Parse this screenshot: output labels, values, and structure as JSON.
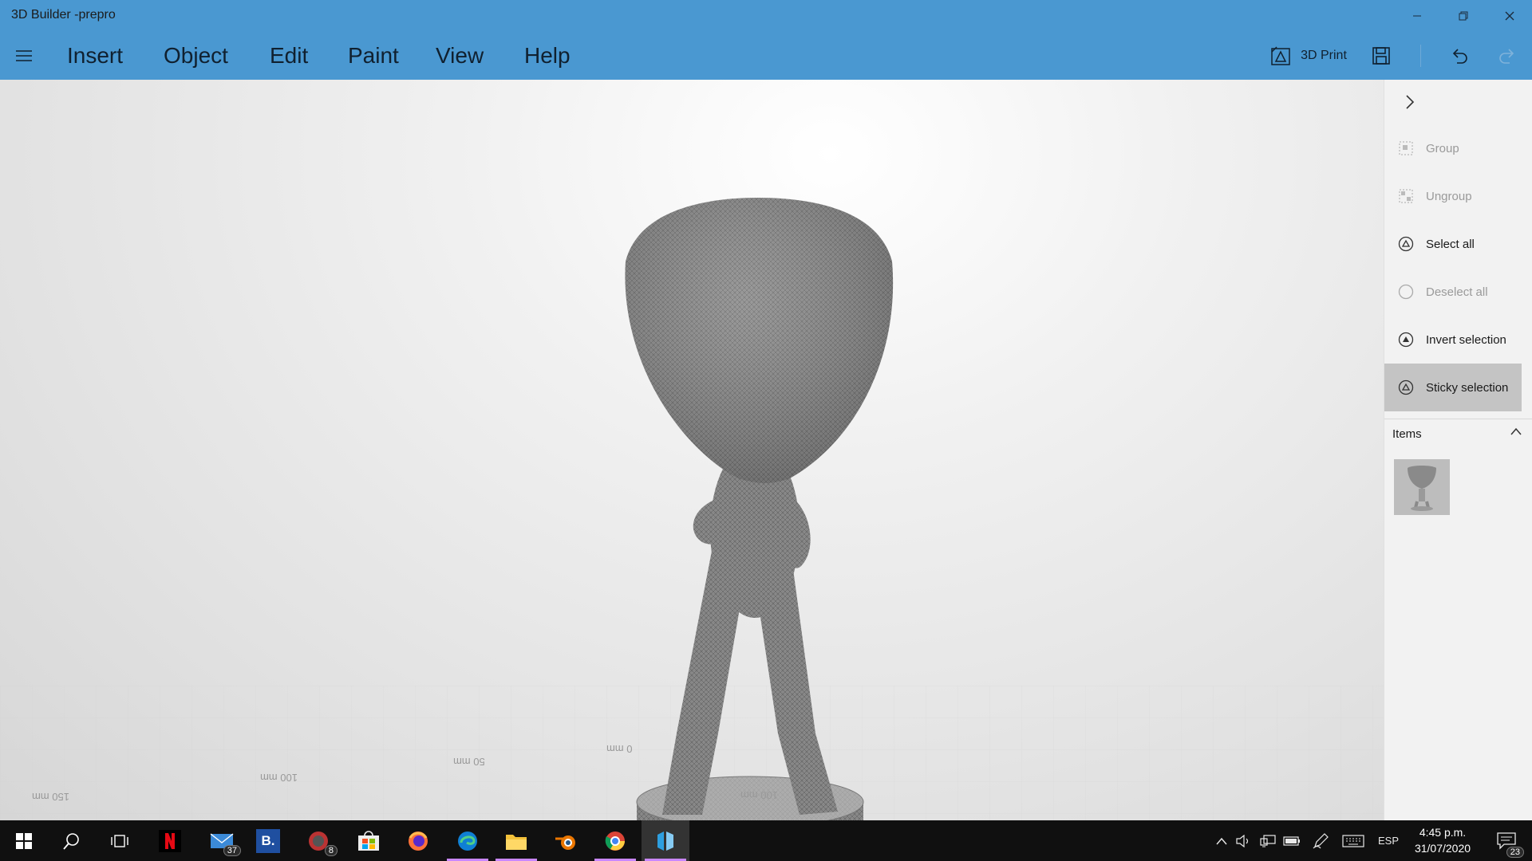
{
  "window": {
    "title": "3D Builder -prepro"
  },
  "menu": {
    "items": [
      {
        "label": "Insert"
      },
      {
        "label": "Object"
      },
      {
        "label": "Edit"
      },
      {
        "label": "Paint"
      },
      {
        "label": "View"
      },
      {
        "label": "Help"
      }
    ],
    "print_label": "3D Print"
  },
  "viewport": {
    "rulers": [
      "150 mm",
      "100 mm",
      "50 mm",
      "0 mm",
      "100 mm"
    ]
  },
  "panel": {
    "commands": [
      {
        "label": "Group",
        "icon": "group-icon",
        "enabled": false
      },
      {
        "label": "Ungroup",
        "icon": "ungroup-icon",
        "enabled": false
      },
      {
        "label": "Select all",
        "icon": "select-all-icon",
        "enabled": true
      },
      {
        "label": "Deselect all",
        "icon": "deselect-all-icon",
        "enabled": false
      },
      {
        "label": "Invert selection",
        "icon": "invert-selection-icon",
        "enabled": true
      },
      {
        "label": "Sticky selection",
        "icon": "sticky-selection-icon",
        "enabled": true,
        "active": true
      }
    ],
    "items_label": "Items"
  },
  "taskbar": {
    "apps": [
      "start",
      "search",
      "task-view",
      "netflix",
      "mail",
      "booking",
      "app-8",
      "store",
      "firefox",
      "edge",
      "file-explorer",
      "blender",
      "chrome",
      "3d-builder"
    ],
    "mail_badge": "37",
    "app8_badge": "8",
    "booking_label": "B.",
    "language": "ESP",
    "time": "4:45 p.m.",
    "date": "31/07/2020",
    "notifications": "23"
  },
  "colors": {
    "titlebar": "#4a98d1",
    "accent_underline": "#c987ff",
    "taskbar": "#101010"
  }
}
